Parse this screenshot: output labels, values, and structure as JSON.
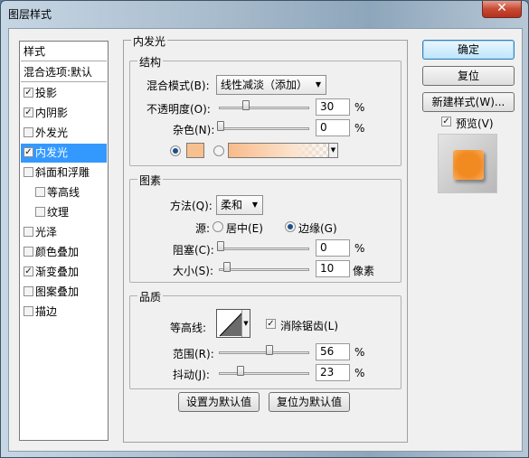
{
  "window": {
    "title": "图层样式",
    "close": "✕"
  },
  "styles_list": {
    "header": "样式",
    "blend_default": "混合选项:默认",
    "items": [
      {
        "label": "投影",
        "checked": true,
        "sub": false
      },
      {
        "label": "内阴影",
        "checked": true,
        "sub": false
      },
      {
        "label": "外发光",
        "checked": false,
        "sub": false
      },
      {
        "label": "内发光",
        "checked": true,
        "sub": false,
        "selected": true
      },
      {
        "label": "斜面和浮雕",
        "checked": false,
        "sub": false
      },
      {
        "label": "等高线",
        "checked": false,
        "sub": true
      },
      {
        "label": "纹理",
        "checked": false,
        "sub": true
      },
      {
        "label": "光泽",
        "checked": false,
        "sub": false
      },
      {
        "label": "颜色叠加",
        "checked": false,
        "sub": false
      },
      {
        "label": "渐变叠加",
        "checked": true,
        "sub": false
      },
      {
        "label": "图案叠加",
        "checked": false,
        "sub": false
      },
      {
        "label": "描边",
        "checked": false,
        "sub": false
      }
    ]
  },
  "panel": {
    "title": "内发光",
    "structure": {
      "label": "结构",
      "blend_mode_label": "混合模式(B):",
      "blend_mode_value": "线性减淡（添加）",
      "opacity_label": "不透明度(O):",
      "opacity_value": "30",
      "noise_label": "杂色(N):",
      "noise_value": "0",
      "percent": "%",
      "color": "#f9c08f",
      "fill_mode": "color"
    },
    "elements": {
      "label": "图素",
      "method_label": "方法(Q):",
      "method_value": "柔和",
      "source_label": "源:",
      "source_center": "居中(E)",
      "source_edge": "边缘(G)",
      "source_selected": "edge",
      "choke_label": "阻塞(C):",
      "choke_value": "0",
      "size_label": "大小(S):",
      "size_value": "10",
      "size_unit": "像素",
      "percent": "%"
    },
    "quality": {
      "label": "品质",
      "contour_label": "等高线:",
      "antialias_label": "消除锯齿(L)",
      "antialias_checked": true,
      "range_label": "范围(R):",
      "range_value": "56",
      "jitter_label": "抖动(J):",
      "jitter_value": "23",
      "percent": "%"
    },
    "make_default": "设置为默认值",
    "reset_default": "复位为默认值"
  },
  "actions": {
    "ok": "确定",
    "reset": "复位",
    "new_style": "新建样式(W)...",
    "preview_label": "预览(V)",
    "preview_checked": true,
    "preview_color": "#f28a22"
  }
}
